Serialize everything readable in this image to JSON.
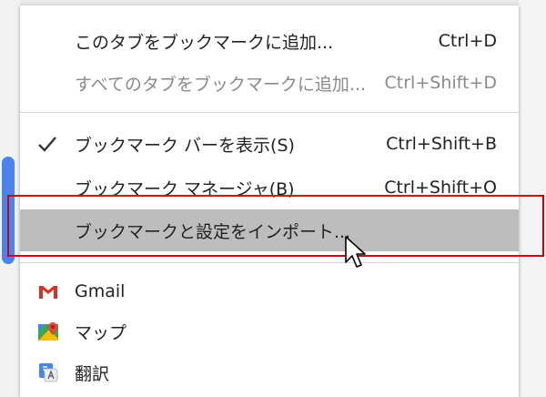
{
  "menu": {
    "items": [
      {
        "label": "このタブをブックマークに追加...",
        "shortcut": "Ctrl+D",
        "disabled": false
      },
      {
        "label": "すべてのタブをブックマークに追加...",
        "shortcut": "Ctrl+Shift+D",
        "disabled": true
      },
      {
        "label": "ブックマーク バーを表示(S)",
        "shortcut": "Ctrl+Shift+B",
        "checked": true
      },
      {
        "label": "ブックマーク マネージャ(B)",
        "shortcut": "Ctrl+Shift+O"
      },
      {
        "label": "ブックマークと設定をインポート...",
        "shortcut": "",
        "highlighted": true
      }
    ],
    "bookmarks": [
      {
        "label": "Gmail",
        "icon": "gmail-icon"
      },
      {
        "label": "マップ",
        "icon": "maps-icon"
      },
      {
        "label": "翻訳",
        "icon": "translate-icon"
      }
    ]
  },
  "colors": {
    "highlight": "#bdbdbd",
    "annotation": "#d00000",
    "gmail_red": "#d93025",
    "translate_blue": "#4285f4"
  }
}
